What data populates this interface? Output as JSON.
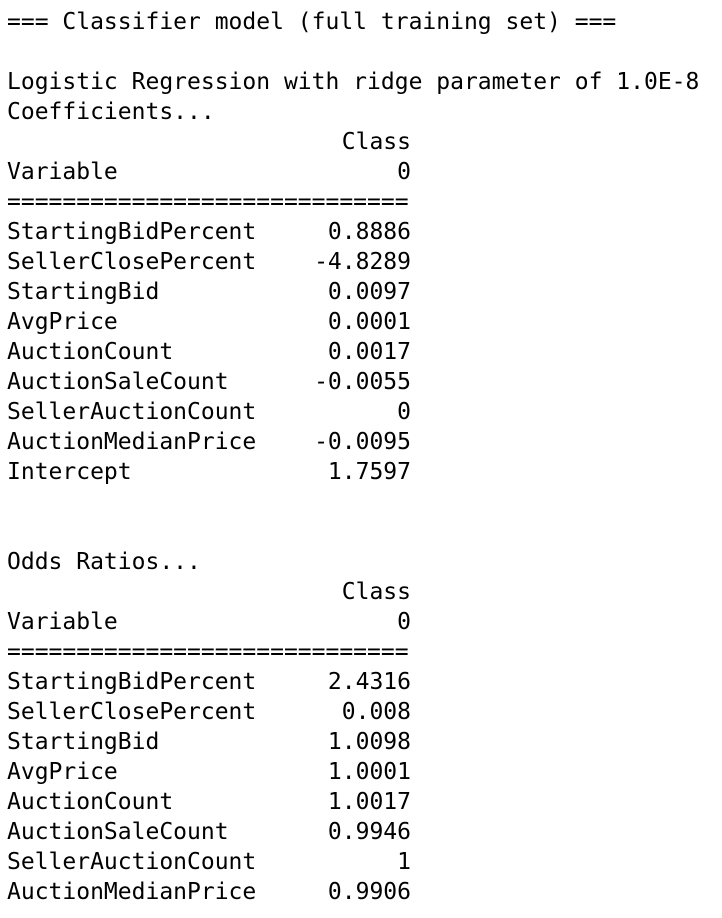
{
  "header": "=== Classifier model (full training set) ===",
  "model_line": "Logistic Regression with ridge parameter of 1.0E-8",
  "coefficients": {
    "title": "Coefficients...",
    "class_header": "Class",
    "variable_header": "Variable",
    "class_value": "0",
    "separator": "=============================",
    "rows": [
      {
        "name": "StartingBidPercent",
        "value": "0.8886"
      },
      {
        "name": "SellerClosePercent",
        "value": "-4.8289"
      },
      {
        "name": "StartingBid",
        "value": "0.0097"
      },
      {
        "name": "AvgPrice",
        "value": "0.0001"
      },
      {
        "name": "AuctionCount",
        "value": "0.0017"
      },
      {
        "name": "AuctionSaleCount",
        "value": "-0.0055"
      },
      {
        "name": "SellerAuctionCount",
        "value": "0"
      },
      {
        "name": "AuctionMedianPrice",
        "value": "-0.0095"
      },
      {
        "name": "Intercept",
        "value": "1.7597"
      }
    ]
  },
  "odds": {
    "title": "Odds Ratios...",
    "class_header": "Class",
    "variable_header": "Variable",
    "class_value": "0",
    "separator": "=============================",
    "rows": [
      {
        "name": "StartingBidPercent",
        "value": "2.4316"
      },
      {
        "name": "SellerClosePercent",
        "value": "0.008"
      },
      {
        "name": "StartingBid",
        "value": "1.0098"
      },
      {
        "name": "AvgPrice",
        "value": "1.0001"
      },
      {
        "name": "AuctionCount",
        "value": "1.0017"
      },
      {
        "name": "AuctionSaleCount",
        "value": "0.9946"
      },
      {
        "name": "SellerAuctionCount",
        "value": "1"
      },
      {
        "name": "AuctionMedianPrice",
        "value": "0.9906"
      }
    ]
  }
}
